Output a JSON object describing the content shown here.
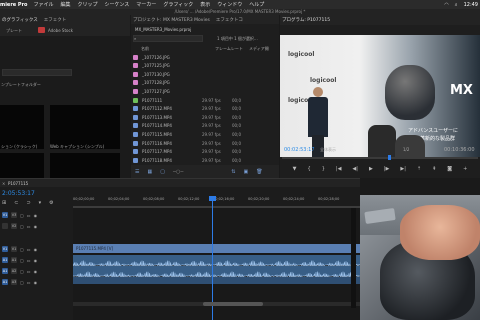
{
  "menubar": {
    "app_name": "miere Pro",
    "items": [
      "ファイル",
      "編集",
      "クリップ",
      "シーケンス",
      "マーカー",
      "グラフィック",
      "表示",
      "ウィンドウ",
      "ヘルプ"
    ],
    "time": "12:49"
  },
  "path_text": "/Users/ ... /Adobe/Premiere Pro/17.0/MX MASTER3 Movies.prproj *",
  "effects": {
    "tabs": [
      "のグラフィックス",
      "エフェクト"
    ],
    "template_label": "プレート",
    "stock_label": "Adobe Stock",
    "folder_label": "ンプレートフォルダー",
    "thumb_labels": [
      "ション (クラシック)",
      "Web キャプション (シンプル)"
    ]
  },
  "project": {
    "tabs": [
      "プロジェクト: MX MASTER3 Movies",
      "エフェクトコ"
    ],
    "project_name": "MX_MASTER3_Movies.prproj",
    "selection_info": "1 項目中 1 個が選択...",
    "columns": {
      "name": "名前",
      "fps": "フレームレート",
      "media": "メディア開"
    },
    "files": [
      {
        "name": "_1077126.JPG",
        "color": "#d681c8",
        "fps": "",
        "dur": ""
      },
      {
        "name": "_1077125.JPG",
        "color": "#d681c8",
        "fps": "",
        "dur": ""
      },
      {
        "name": "_1077130.JPG",
        "color": "#d681c8",
        "fps": "",
        "dur": ""
      },
      {
        "name": "_1077128.JPG",
        "color": "#d681c8",
        "fps": "",
        "dur": ""
      },
      {
        "name": "_1077127.JPG",
        "color": "#d681c8",
        "fps": "",
        "dur": ""
      },
      {
        "name": "P1077111",
        "color": "#6fbf5a",
        "fps": "29.97 fps",
        "dur": "00;0"
      },
      {
        "name": "P1077112.MP4",
        "color": "#7096d6",
        "fps": "29.97 fps",
        "dur": "00;0"
      },
      {
        "name": "P1077113.MP4",
        "color": "#7096d6",
        "fps": "29.97 fps",
        "dur": "00;0"
      },
      {
        "name": "P1077114.MP4",
        "color": "#7096d6",
        "fps": "29.97 fps",
        "dur": "00;0"
      },
      {
        "name": "P1077115.MP4",
        "color": "#7096d6",
        "fps": "29.97 fps",
        "dur": "00;0"
      },
      {
        "name": "P1077116.MP4",
        "color": "#7096d6",
        "fps": "29.97 fps",
        "dur": "00;0"
      },
      {
        "name": "P1077117.MP4",
        "color": "#7096d6",
        "fps": "29.97 fps",
        "dur": "00;0"
      },
      {
        "name": "P1077118.MP4",
        "color": "#7096d6",
        "fps": "29.97 fps",
        "dur": "00;0"
      }
    ]
  },
  "program": {
    "title": "プログラム: P1077115",
    "timecode": "00:02:53:17",
    "fit_label": "全体表示",
    "ratio": "1/2",
    "duration": "00:10:36:00",
    "video_text": {
      "brand": "logicool",
      "mx": "MX",
      "caption1": "アドバンスユーザーに",
      "caption2": "革新的な製品群"
    }
  },
  "timeline": {
    "sequence_name": "P1077115",
    "timecode": "2:05:53:17",
    "ruler": [
      "00;02;00;00",
      "00;02;04;00",
      "00;02;08;00",
      "00;02;12;00",
      "00;02;16;00",
      "00;02;20;00",
      "00;02;24;00",
      "00;02;28;00"
    ],
    "tracks": [
      {
        "label": "V3",
        "a": "V1"
      },
      {
        "label": "V2",
        "a": ""
      },
      {
        "label": "V1",
        "a": "V1"
      },
      {
        "label": "A1",
        "a": "A1"
      },
      {
        "label": "A2",
        "a": "A1"
      },
      {
        "label": "A3",
        "a": "A1"
      }
    ],
    "clip_label": "P1077115.MP4 [V]"
  },
  "colors": {
    "accent_blue": "#2f6fe0",
    "playhead": "#2d7be6",
    "clip_blue": "#5a7fb3",
    "timecode_blue": "#2d8ce6"
  }
}
